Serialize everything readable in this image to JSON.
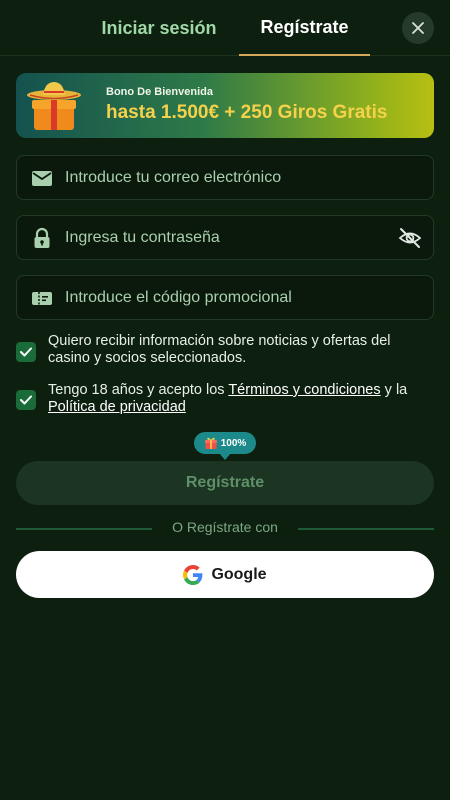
{
  "tabs": {
    "login": "Iniciar sesión",
    "register": "Regístrate"
  },
  "bonus": {
    "kicker": "Bono De Bienvenida",
    "headline": "hasta 1.500€ + 250 Giros Gratis"
  },
  "fields": {
    "email_placeholder": "Introduce tu correo electrónico",
    "password_placeholder": "Ingresa tu contraseña",
    "promo_placeholder": "Introduce el código promocional"
  },
  "consents": {
    "news_text": "Quiero recibir información sobre noticias y ofertas del casino y socios seleccionados.",
    "terms_prefix": "Tengo 18 años y acepto los ",
    "terms_link": "Términos y condiciones",
    "terms_mid": " y la ",
    "privacy_link": "Política de privacidad",
    "news_checked": true,
    "terms_checked": true
  },
  "badge": {
    "text": "100%"
  },
  "submit_label": "Regístrate",
  "divider_text": "O Regístrate con",
  "google_label": "Google",
  "colors": {
    "background": "#0d1f0e",
    "accent_gold": "#f6d24a",
    "active_tab_underline": "#d4a95a",
    "checkbox": "#1a6b3a"
  },
  "icons": [
    "close-icon",
    "gift-sombrero-icon",
    "email-icon",
    "lock-icon",
    "eye-off-icon",
    "ticket-icon",
    "check-icon",
    "gift-icon",
    "google-icon"
  ]
}
